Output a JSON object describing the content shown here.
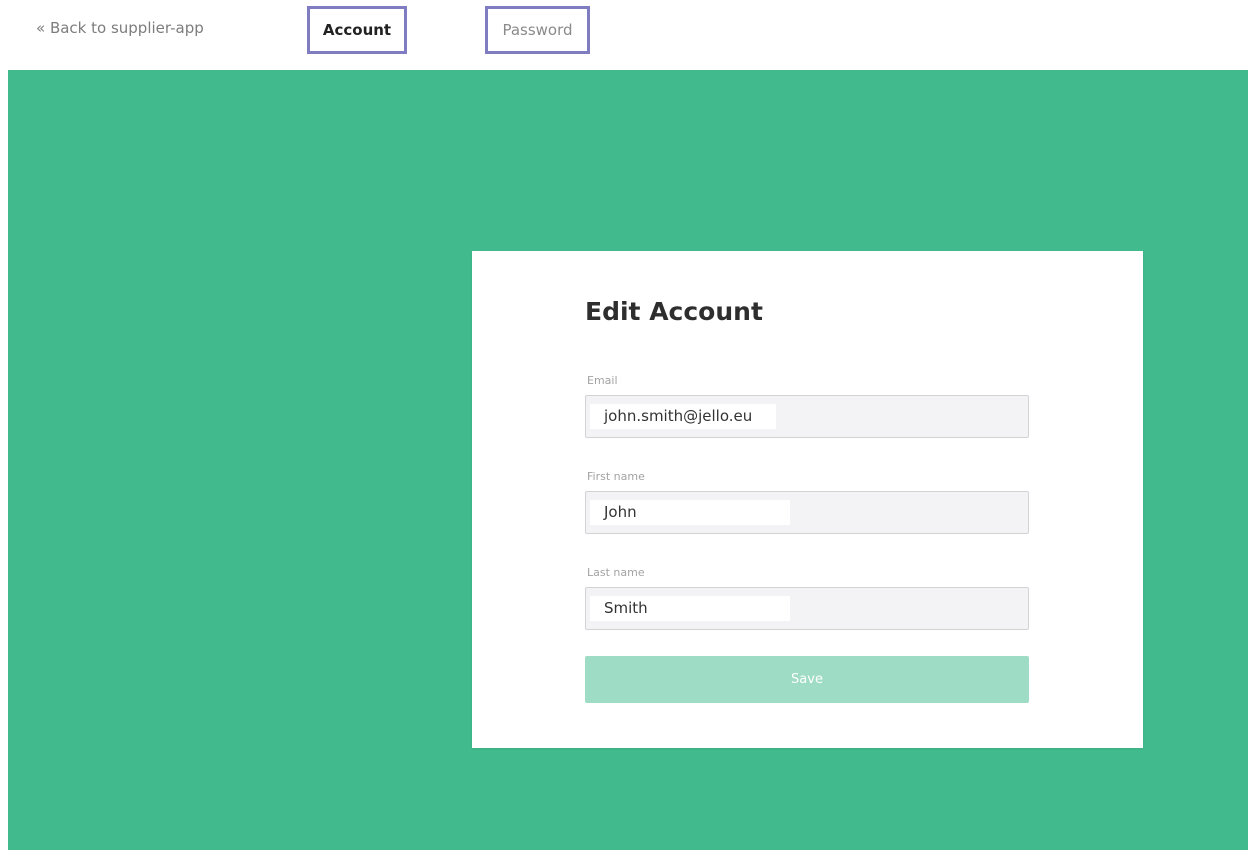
{
  "nav": {
    "back_label": "« Back to supplier-app",
    "tabs": [
      {
        "label": "Account",
        "active": true
      },
      {
        "label": "Password",
        "active": false
      }
    ]
  },
  "form": {
    "title": "Edit Account",
    "fields": [
      {
        "label": "Email",
        "value": "john.smith@jello.eu"
      },
      {
        "label": "First name",
        "value": "John"
      },
      {
        "label": "Last name",
        "value": "Smith"
      }
    ],
    "save_label": "Save"
  },
  "colors": {
    "background_accent": "#41bb8d",
    "button": "#9fdcc5",
    "tab_highlight_border": "#7f7cc1"
  }
}
